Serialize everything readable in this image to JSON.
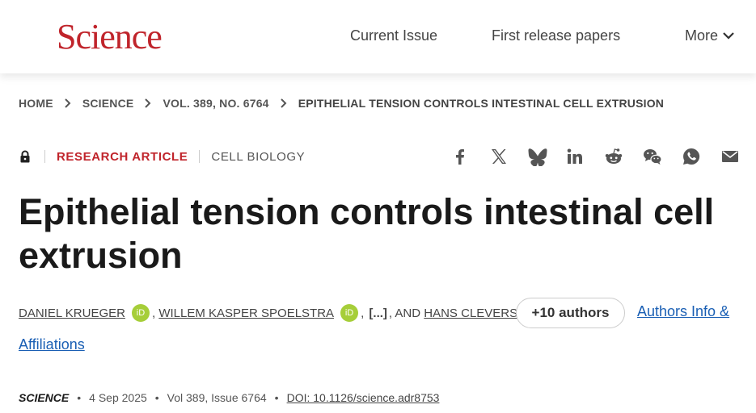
{
  "header": {
    "logo": "Science",
    "nav": [
      "Current Issue",
      "First release papers",
      "More"
    ]
  },
  "breadcrumb": [
    "HOME",
    "SCIENCE",
    "VOL. 389, NO. 6764",
    "EPITHELIAL TENSION CONTROLS INTESTINAL CELL EXTRUSION"
  ],
  "article": {
    "type": "RESEARCH ARTICLE",
    "category": "CELL BIOLOGY",
    "title": "Epithelial tension controls intestinal cell extrusion",
    "authors": [
      "DANIEL KRUEGER",
      "WILLEM KASPER SPOELSTRA",
      "HANS CLEVERS"
    ],
    "orcid_label": "iD",
    "ellipsis": "[...]",
    "and": ", AND",
    "more_authors": "+10 authors",
    "affiliations_link": [
      "Authors Info &",
      "Affiliations"
    ],
    "journal": "SCIENCE",
    "date": "4 Sep 2025",
    "volume": "Vol 389, Issue 6764",
    "doi": "DOI: 10.1126/science.adr8753"
  },
  "share_icons": [
    "facebook-icon",
    "x-icon",
    "bluesky-icon",
    "linkedin-icon",
    "reddit-icon",
    "wechat-icon",
    "whatsapp-icon",
    "email-icon"
  ],
  "colors": {
    "brand": "#c0242b",
    "link": "#1a5fb4",
    "orcid": "#a6ce39"
  }
}
